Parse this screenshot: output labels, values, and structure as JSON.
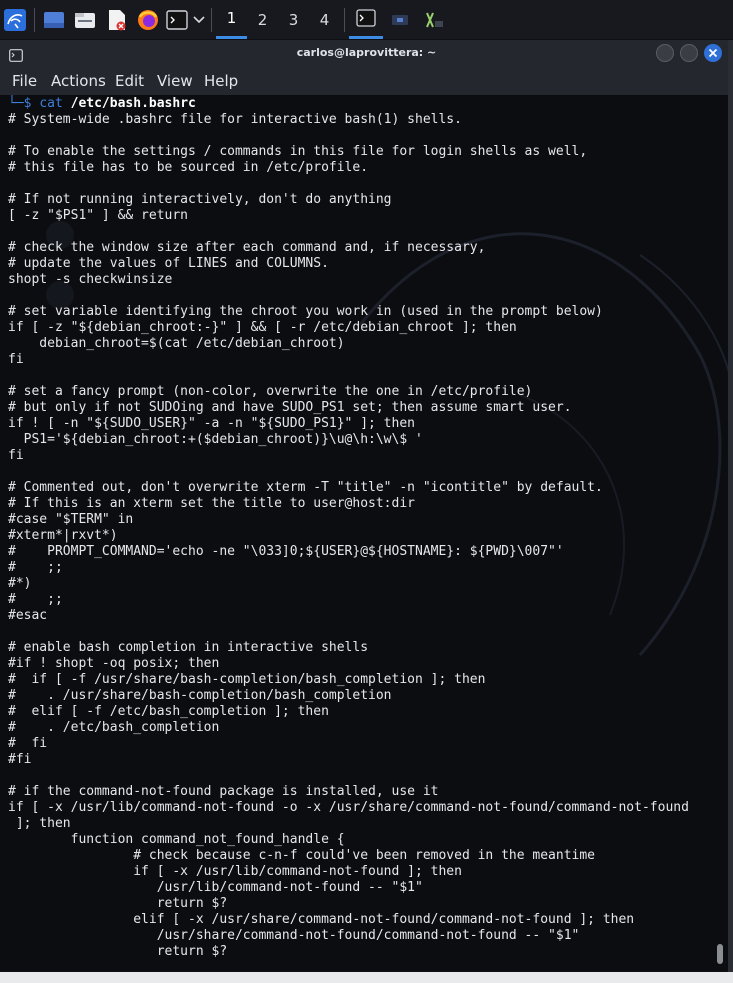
{
  "panel": {
    "workspaces": [
      "1",
      "2",
      "3",
      "4"
    ],
    "active_workspace": "1",
    "icons": [
      "kali-menu-icon",
      "show-desktop-icon",
      "file-manager-icon",
      "text-editor-icon",
      "firefox-icon",
      "terminal-icon",
      "chevron-down-icon"
    ]
  },
  "window": {
    "title": "carlos@laprovittera: ~",
    "menu": [
      "File",
      "Actions",
      "Edit",
      "View",
      "Help"
    ]
  },
  "terminal": {
    "prompt_arrow": "└─$",
    "command": "cat",
    "argument": "/etc/bash.bashrc",
    "lines": [
      "# System-wide .bashrc file for interactive bash(1) shells.",
      "",
      "# To enable the settings / commands in this file for login shells as well,",
      "# this file has to be sourced in /etc/profile.",
      "",
      "# If not running interactively, don't do anything",
      "[ -z \"$PS1\" ] && return",
      "",
      "# check the window size after each command and, if necessary,",
      "# update the values of LINES and COLUMNS.",
      "shopt -s checkwinsize",
      "",
      "# set variable identifying the chroot you work in (used in the prompt below)",
      "if [ -z \"${debian_chroot:-}\" ] && [ -r /etc/debian_chroot ]; then",
      "    debian_chroot=$(cat /etc/debian_chroot)",
      "fi",
      "",
      "# set a fancy prompt (non-color, overwrite the one in /etc/profile)",
      "# but only if not SUDOing and have SUDO_PS1 set; then assume smart user.",
      "if ! [ -n \"${SUDO_USER}\" -a -n \"${SUDO_PS1}\" ]; then",
      "  PS1='${debian_chroot:+($debian_chroot)}\\u@\\h:\\w\\$ '",
      "fi",
      "",
      "# Commented out, don't overwrite xterm -T \"title\" -n \"icontitle\" by default.",
      "# If this is an xterm set the title to user@host:dir",
      "#case \"$TERM\" in",
      "#xterm*|rxvt*)",
      "#    PROMPT_COMMAND='echo -ne \"\\033]0;${USER}@${HOSTNAME}: ${PWD}\\007\"'",
      "#    ;;",
      "#*)",
      "#    ;;",
      "#esac",
      "",
      "# enable bash completion in interactive shells",
      "#if ! shopt -oq posix; then",
      "#  if [ -f /usr/share/bash-completion/bash_completion ]; then",
      "#    . /usr/share/bash-completion/bash_completion",
      "#  elif [ -f /etc/bash_completion ]; then",
      "#    . /etc/bash_completion",
      "#  fi",
      "#fi",
      "",
      "# if the command-not-found package is installed, use it",
      "if [ -x /usr/lib/command-not-found -o -x /usr/share/command-not-found/command-not-found",
      " ]; then",
      "        function command_not_found_handle {",
      "                # check because c-n-f could've been removed in the meantime",
      "                if [ -x /usr/lib/command-not-found ]; then",
      "                   /usr/lib/command-not-found -- \"$1\"",
      "                   return $?",
      "                elif [ -x /usr/share/command-not-found/command-not-found ]; then",
      "                   /usr/share/command-not-found/command-not-found -- \"$1\"",
      "                   return $?"
    ]
  },
  "colors": {
    "accent": "#3c8ce6",
    "close_button": "#2f6fd8",
    "terminal_bg": "#0c0d11",
    "text": "#e6e7ea"
  }
}
